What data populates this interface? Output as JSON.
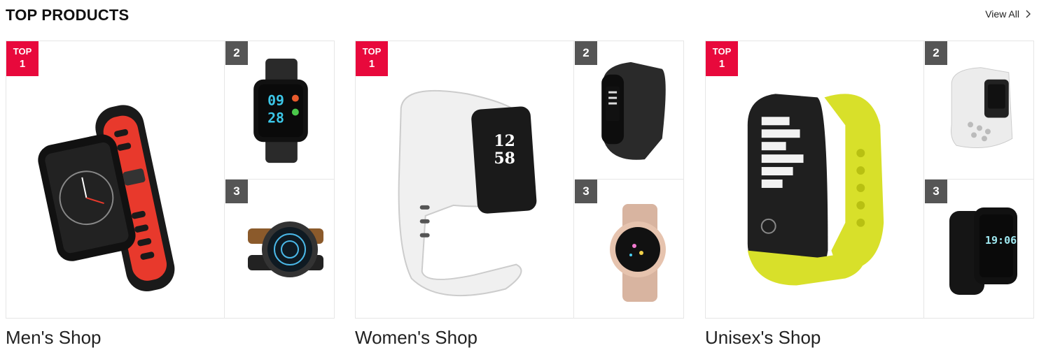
{
  "header": {
    "title": "TOP PRODUCTS",
    "view_all": "View All"
  },
  "colors": {
    "accent": "#e8093c",
    "rank_badge": "#555555",
    "border": "#e6e6e6"
  },
  "groups": [
    {
      "shop": "Men's Shop",
      "top_label": "TOP",
      "top_rank": "1",
      "rank2": "2",
      "rank3": "3",
      "products": [
        "smartwatch-red-black-icon",
        "smartwatch-mesh-black-icon",
        "smartwatch-round-leather-icon"
      ]
    },
    {
      "shop": "Women's Shop",
      "top_label": "TOP",
      "top_rank": "1",
      "rank2": "2",
      "rank3": "3",
      "products": [
        "fitness-band-white-icon",
        "fitness-band-black-icon",
        "smartwatch-rosegold-icon"
      ]
    },
    {
      "shop": "Unisex's Shop",
      "top_label": "TOP",
      "top_rank": "1",
      "rank2": "2",
      "rank3": "3",
      "products": [
        "fitness-band-lime-icon",
        "fitness-band-white-gray-icon",
        "smartwatch-black-square-icon"
      ]
    }
  ]
}
